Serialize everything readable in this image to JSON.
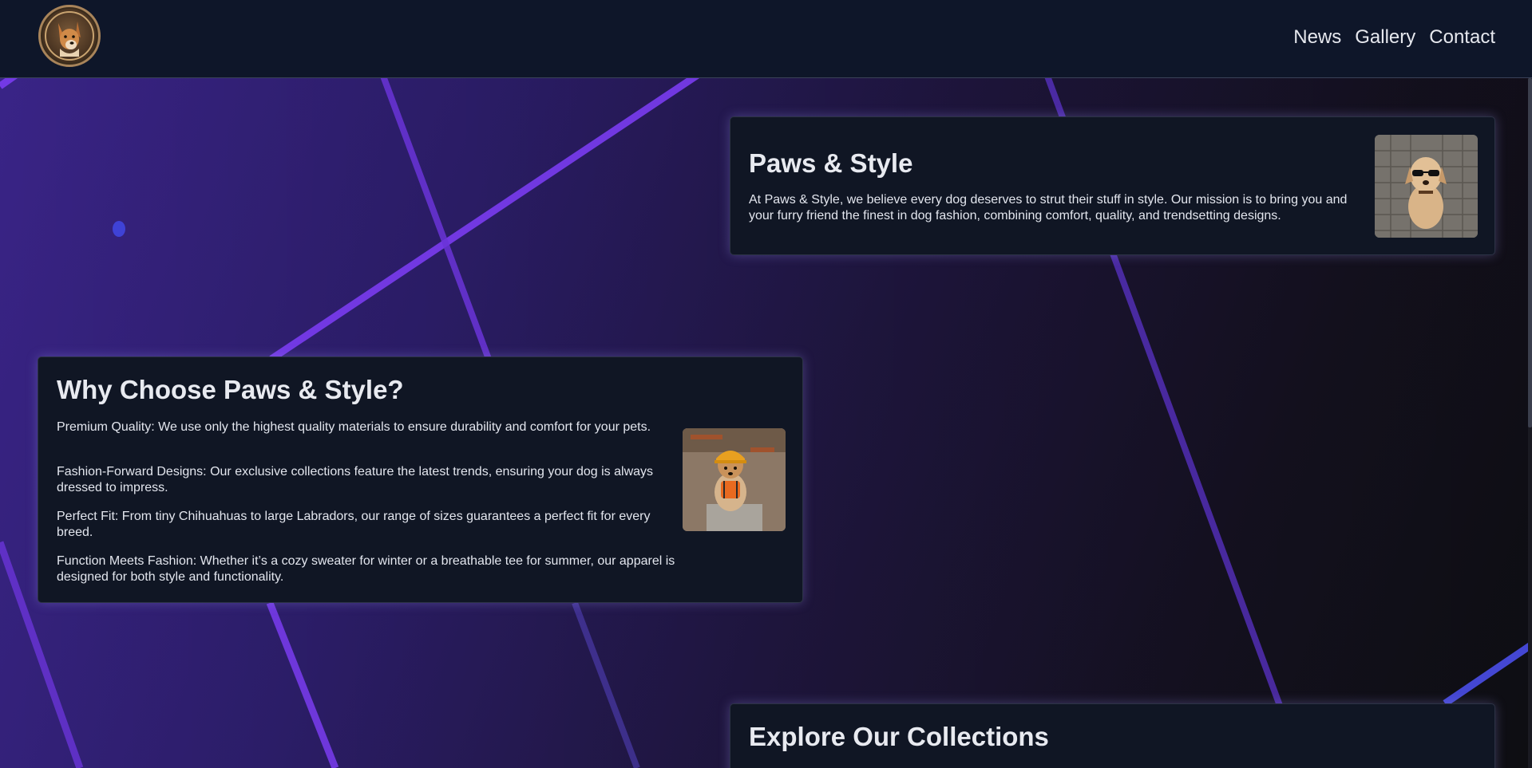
{
  "header": {
    "logo_alt": "dog logo",
    "nav": [
      {
        "label": "News"
      },
      {
        "label": "Gallery"
      },
      {
        "label": "Contact"
      }
    ]
  },
  "about": {
    "title": "Paws & Style",
    "text": "At Paws & Style, we believe every dog deserves to strut their stuff in style. Our mission is to bring you and your furry friend the finest in dog fashion, combining comfort, quality, and trendsetting designs.",
    "image_icon": "dog-with-sunglasses-photo"
  },
  "why": {
    "title": "Why Choose Paws & Style?",
    "points": [
      "Premium Quality: We use only the highest quality materials to ensure durability and comfort for your pets.",
      "Fashion-Forward Designs: Our exclusive collections feature the latest trends, ensuring your dog is always dressed to impress.",
      "Perfect Fit: From tiny Chihuahuas to large Labradors, our range of sizes guarantees a perfect fit for every breed.",
      "Function Meets Fashion: Whether it’s a cozy sweater for winter or a breathable tee for summer, our apparel is designed for both style and functionality."
    ],
    "image_icon": "dog-in-hardhat-photo"
  },
  "explore": {
    "title": "Explore Our Collections"
  },
  "colors": {
    "header_bg": "#0e1629",
    "card_bg": "#101624",
    "accent_purple": "#7a3cf0",
    "accent_blue": "#4a4ee8",
    "text": "#e6e8ee"
  }
}
